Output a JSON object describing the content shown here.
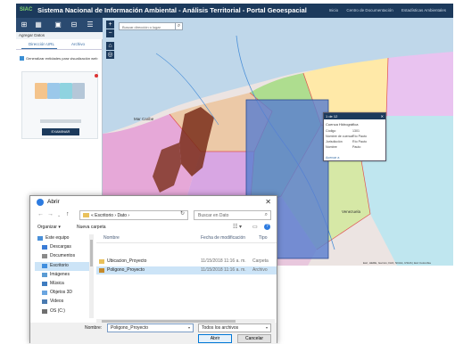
{
  "portal": {
    "logo": "SIAC",
    "title": "Sistema Nacional de Información Ambiental - Análisis Territorial - Portal Geoespacial",
    "top_links": [
      "Inicio",
      "Centro de Documentación",
      "Estadísticas Ambientales"
    ],
    "panel": {
      "header": "Agregar Datos",
      "tabs": [
        "Dirección URL",
        "Archivo"
      ],
      "checkbox_label": "Generalizar entidades para visualización web",
      "upload_button": "EXAMINAR"
    },
    "map": {
      "search_placeholder": "Buscar dirección o lugar",
      "labels": [
        "Mar Caribe",
        "Venezuela"
      ],
      "attribution": "Esri, HERE, Garmin, FAO, NOAA, USGS | Esri Colombia"
    },
    "popup": {
      "title": "1 de 12",
      "layer": "Cuenca Hidrográfica",
      "rows": [
        {
          "label": "Código",
          "value": "1301"
        },
        {
          "label": "Nombre de cuenca",
          "value": "Río Pauto"
        },
        {
          "label": "Jurisdicción",
          "value": "Río Pauto"
        },
        {
          "label": "Nombre",
          "value": "Pauto"
        }
      ],
      "footer": "Acercar a"
    }
  },
  "dialog": {
    "title": "Abrir",
    "path": "« Escritorio › Dato ›",
    "search_placeholder": "Buscar en Dato",
    "organize": "Organizar ▾",
    "new_folder": "Nueva carpeta",
    "nav_items": [
      {
        "label": "Este equipo",
        "icon": "computer-icon",
        "color": "#4a90d9",
        "selected": false
      },
      {
        "label": "Descargas",
        "icon": "download-icon",
        "color": "#3a7bd5",
        "selected": false
      },
      {
        "label": "Documentos",
        "icon": "document-icon",
        "color": "#8a8a8a",
        "selected": false
      },
      {
        "label": "Escritorio",
        "icon": "desktop-icon",
        "color": "#3f8ede",
        "selected": true
      },
      {
        "label": "Imágenes",
        "icon": "image-icon",
        "color": "#5a9bd4",
        "selected": false
      },
      {
        "label": "Música",
        "icon": "music-icon",
        "color": "#3f7cc0",
        "selected": false
      },
      {
        "label": "Objetos 3D",
        "icon": "cube-icon",
        "color": "#6aa5e0",
        "selected": false
      },
      {
        "label": "Videos",
        "icon": "video-icon",
        "color": "#4a7ab0",
        "selected": false
      },
      {
        "label": "OS (C:)",
        "icon": "drive-icon",
        "color": "#6f6f6f",
        "selected": false
      }
    ],
    "columns": [
      "Nombre",
      "Fecha de modificación",
      "Tipo"
    ],
    "files": [
      {
        "name": "Ubicacion_Proyecto",
        "date": "11/15/2018 11:16 a. m.",
        "type": "Carpeta",
        "icon": "folder-icon",
        "color": "#e9c15c",
        "selected": false
      },
      {
        "name": "Poligono_Proyecto",
        "date": "11/15/2018 11:16 a. m.",
        "type": "Archivo",
        "icon": "zip-file-icon",
        "color": "#c58a2b",
        "selected": true
      }
    ],
    "name_label": "Nombre:",
    "name_value": "Poligono_Proyecto",
    "filter": "Todos los archivos",
    "open_button": "Abrir",
    "cancel_button": "Cancelar"
  }
}
